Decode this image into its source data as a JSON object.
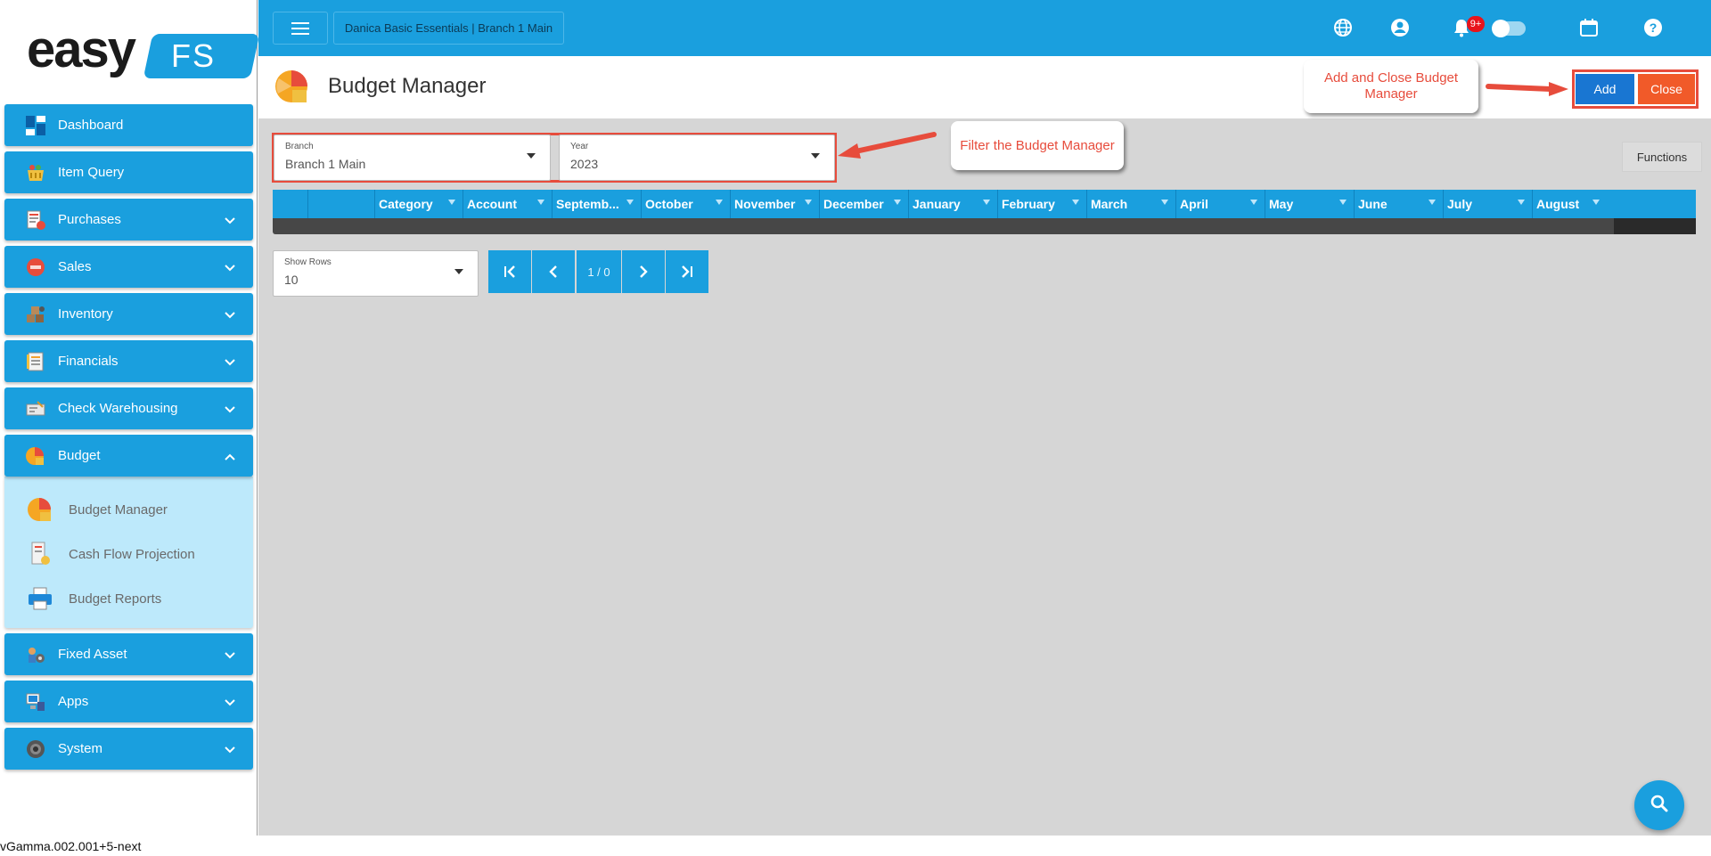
{
  "app": {
    "logo_text": "easy",
    "logo_badge": "FS",
    "version": "vGamma.002.001+5-next"
  },
  "topbar": {
    "breadcrumb": "Danica Basic Essentials | Branch 1 Main",
    "notification_count": "9+",
    "icons": [
      "menu-icon",
      "globe-icon",
      "user-icon",
      "bell-icon",
      "theme-toggle",
      "moon-icon",
      "calendar-icon",
      "help-icon"
    ]
  },
  "sidebar": {
    "items": [
      {
        "label": "Dashboard",
        "icon": "dashboard-icon",
        "expandable": false
      },
      {
        "label": "Item Query",
        "icon": "basket-icon",
        "expandable": false
      },
      {
        "label": "Purchases",
        "icon": "purchases-icon",
        "expandable": true
      },
      {
        "label": "Sales",
        "icon": "sale-tag-icon",
        "expandable": true
      },
      {
        "label": "Inventory",
        "icon": "boxes-icon",
        "expandable": true
      },
      {
        "label": "Financials",
        "icon": "ledger-icon",
        "expandable": true
      },
      {
        "label": "Check Warehousing",
        "icon": "check-icon",
        "expandable": true
      },
      {
        "label": "Budget",
        "icon": "pie-chart-icon",
        "expandable": true,
        "expanded": true
      },
      {
        "label": "Fixed Asset",
        "icon": "asset-icon",
        "expandable": true
      },
      {
        "label": "Apps",
        "icon": "apps-icon",
        "expandable": true
      },
      {
        "label": "System",
        "icon": "gear-icon",
        "expandable": true
      }
    ],
    "budget_submenu": [
      {
        "label": "Budget Manager",
        "icon": "pie-chart-icon"
      },
      {
        "label": "Cash Flow Projection",
        "icon": "cashflow-icon"
      },
      {
        "label": "Budget Reports",
        "icon": "printer-icon"
      }
    ]
  },
  "page": {
    "title": "Budget Manager",
    "add_label": "Add",
    "close_label": "Close",
    "functions_label": "Functions"
  },
  "filters": {
    "branch": {
      "label": "Branch",
      "value": "Branch 1 Main"
    },
    "year": {
      "label": "Year",
      "value": "2023"
    }
  },
  "grid": {
    "columns": [
      "",
      "",
      "Category",
      "Account",
      "Septemb...",
      "October",
      "November",
      "December",
      "January",
      "February",
      "March",
      "April",
      "May",
      "June",
      "July",
      "August"
    ]
  },
  "pagination": {
    "show_rows_label": "Show Rows",
    "show_rows_value": "10",
    "page_info": "1 / 0"
  },
  "callouts": {
    "add_close": "Add and Close Budget Manager",
    "filter": "Filter the Budget Manager"
  },
  "colors": {
    "primary": "#1a9fde",
    "add": "#1976d2",
    "close": "#f15a29",
    "annotation": "#e74c3c",
    "content_bg": "#d6d6d6",
    "submenu_bg": "#bde9fb"
  }
}
